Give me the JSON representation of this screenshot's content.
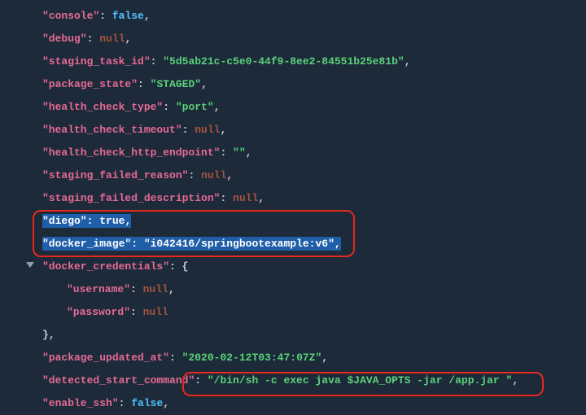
{
  "json": {
    "console": {
      "key": "\"console\"",
      "val": "false",
      "type": "bool"
    },
    "debug": {
      "key": "\"debug\"",
      "val": "null",
      "type": "null"
    },
    "staging_task_id": {
      "key": "\"staging_task_id\"",
      "val": "\"5d5ab21c-c5e0-44f9-8ee2-84551b25e81b\"",
      "type": "str"
    },
    "package_state": {
      "key": "\"package_state\"",
      "val": "\"STAGED\"",
      "type": "str"
    },
    "health_check_type": {
      "key": "\"health_check_type\"",
      "val": "\"port\"",
      "type": "str"
    },
    "health_check_timeout": {
      "key": "\"health_check_timeout\"",
      "val": "null",
      "type": "null"
    },
    "health_check_http_endpoint": {
      "key": "\"health_check_http_endpoint\"",
      "val": "\"\"",
      "type": "str"
    },
    "staging_failed_reason": {
      "key": "\"staging_failed_reason\"",
      "val": "null",
      "type": "null"
    },
    "staging_failed_description": {
      "key": "\"staging_failed_description\"",
      "val": "null",
      "type": "null"
    },
    "diego": {
      "key": "\"diego\"",
      "val": "true",
      "type": "bool"
    },
    "docker_image": {
      "key": "\"docker_image\"",
      "val": "\"i042416/springbootexample:v6\"",
      "type": "str"
    },
    "docker_credentials": {
      "key": "\"docker_credentials\"",
      "open": "{"
    },
    "username": {
      "key": "\"username\"",
      "val": "null",
      "type": "null"
    },
    "password": {
      "key": "\"password\"",
      "val": "null",
      "type": "null"
    },
    "close_brace": "},",
    "package_updated_at": {
      "key": "\"package_updated_at\"",
      "val": "\"2020-02-12T03:47:07Z\"",
      "type": "str"
    },
    "detected_start_command": {
      "key": "\"detected_start_command\"",
      "val": "\"/bin/sh -c exec java $JAVA_OPTS -jar /app.jar \"",
      "type": "str"
    },
    "enable_ssh": {
      "key": "\"enable_ssh\"",
      "val": "false",
      "type": "bool"
    }
  }
}
